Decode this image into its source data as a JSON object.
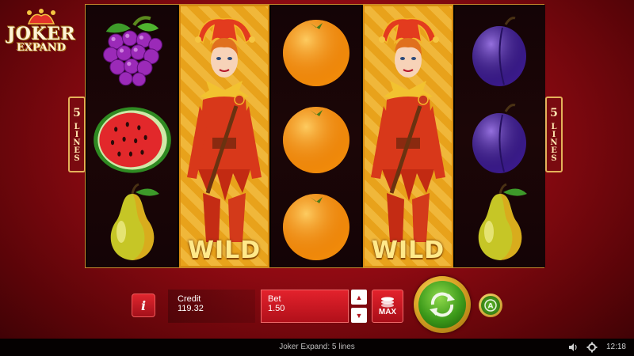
{
  "game": {
    "logo_line1": "JOKER",
    "logo_line2": "EXPAND",
    "lines_number": "5",
    "lines_word": "LINES"
  },
  "reels": [
    {
      "symbols": [
        "grapes",
        "watermelon",
        "pear"
      ],
      "wild": false
    },
    {
      "symbols": [
        "joker"
      ],
      "wild": true,
      "label": "WILD"
    },
    {
      "symbols": [
        "orange",
        "orange",
        "orange"
      ],
      "wild": false
    },
    {
      "symbols": [
        "joker"
      ],
      "wild": true,
      "label": "WILD"
    },
    {
      "symbols": [
        "plum",
        "plum",
        "pear"
      ],
      "wild": false
    }
  ],
  "controls": {
    "info_label": "i",
    "credit_label": "Credit",
    "credit_value": "119.32",
    "bet_label": "Bet",
    "bet_value": "1.50",
    "max_label": "MAX",
    "bet_up_icon": "triangle-up-icon",
    "bet_down_icon": "triangle-down-icon",
    "spin_icon": "spin-arrows-icon",
    "autoplay_icon": "autoplay-icon",
    "autoplay_letter": "A"
  },
  "status_bar": {
    "title": "Joker Expand: 5 lines",
    "time": "12:18"
  },
  "colors": {
    "background": "#8e0a12",
    "gold": "#e4b25a",
    "spin_green": "#3c9a1a",
    "bet_red": "#e3222c"
  }
}
